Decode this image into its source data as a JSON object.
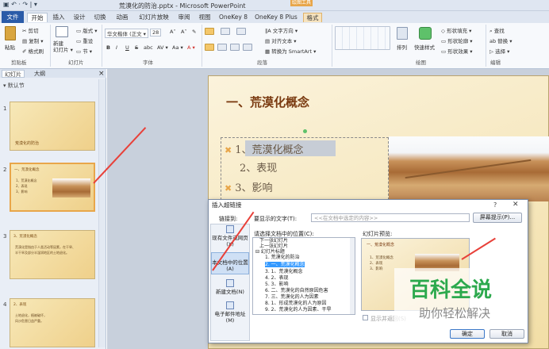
{
  "window": {
    "title": "荒漠化的防治.pptx - Microsoft PowerPoint",
    "quick_access": "▣ ↶ · ↷ | ▾",
    "contextual_group": "绘图工具"
  },
  "tabs": [
    "文件",
    "开始",
    "插入",
    "设计",
    "切换",
    "动画",
    "幻灯片放映",
    "审阅",
    "视图",
    "OneKey 8",
    "OneKey 8 Plus",
    "格式"
  ],
  "ribbon": {
    "clipboard": {
      "paste": "粘贴",
      "cut": "✂ 剪切",
      "copy": "▤ 复制 ▾",
      "format_painter": "✐ 格式刷",
      "label": "剪贴板"
    },
    "slides": {
      "new_slide": "新建\n幻灯片 ▾",
      "layout": "▭ 版式 ▾",
      "reset": "▭ 重设",
      "section": "▭ 节 ▾",
      "label": "幻灯片"
    },
    "font": {
      "name": "华文楷体 (正文 ▾",
      "size": "28",
      "grow": "A˄",
      "shrink": "A˅",
      "clear": "✎",
      "bold": "B",
      "italic": "I",
      "underline": "U",
      "strike": "S",
      "shadow": "abc",
      "spacing": "AV ▾",
      "case": "Aa ▾",
      "color": "A ▾",
      "label": "字体"
    },
    "paragraph": {
      "text_direction": "‖A 文字方向 ▾",
      "align_text": "▤ 对齐文本 ▾",
      "smartart": "▦ 转换为 SmartArt ▾",
      "label": "段落"
    },
    "drawing": {
      "arrange": "排列",
      "quick_styles": "快速样式",
      "fill": "◇ 形状填充 ▾",
      "outline": "▭ 形状轮廓 ▾",
      "effects": "▭ 形状效果 ▾",
      "label": "绘图"
    },
    "editing": {
      "find": "⌕ 查找",
      "replace": "ab 替换 ▾",
      "select": "▷ 选择 ▾",
      "label": "编辑"
    }
  },
  "left_pane": {
    "tabs": [
      "幻灯片",
      "大纲"
    ],
    "close": "×",
    "section": "▾ 默认节",
    "slides": [
      {
        "num": "1",
        "title": "荒漠化的防治",
        "lines": []
      },
      {
        "num": "2",
        "title": "一、荒漠化概念",
        "lines": [
          "1、荒漠化概念",
          "2、表现",
          "3、影响"
        ]
      },
      {
        "num": "3",
        "title": "3、荒漠化概念",
        "lines": [
          "荒漠化是指由于人类活动等因素，在干旱、",
          "半干旱及部分半湿润地区的土地退化。"
        ]
      },
      {
        "num": "4",
        "title": "2、表现",
        "lines": [
          "土地退化，植被破坏，",
          "风沙危害日益严重。"
        ]
      }
    ]
  },
  "slide": {
    "title": "一、荒漠化概念",
    "bullets": [
      {
        "marker": "✖",
        "text": "1、荒漠化概念"
      },
      {
        "marker": "",
        "text": "2、表现"
      },
      {
        "marker": "✖",
        "text": "3、影响"
      }
    ]
  },
  "dialog": {
    "title": "插入超链接",
    "help": "?",
    "close": "✕",
    "link_to": "链接到:",
    "display_text_label": "要显示的文字(T):",
    "display_text_value": "<<在文档中选定的内容>>",
    "screen_tip": "屏幕提示(P)...",
    "place_label": "请选择文档中的位置(C):",
    "preview_label": "幻灯片预览:",
    "link_options": [
      {
        "label": "现有文件或网页(X)",
        "selected": false
      },
      {
        "label": "本文档中的位置(A)",
        "selected": true
      },
      {
        "label": "新建文档(N)",
        "selected": false
      },
      {
        "label": "电子邮件地址(M)",
        "selected": false
      }
    ],
    "tree": [
      {
        "text": "下一张幻灯片",
        "selected": false
      },
      {
        "text": "上一张幻灯片",
        "selected": false
      },
      {
        "text": "⊟ 幻灯片标题",
        "selected": false
      },
      {
        "text": "1. 荒漠化的防治",
        "selected": false
      },
      {
        "text": "2. 一、荒漠化概念",
        "selected": true
      },
      {
        "text": "3. 1、荒漠化概念",
        "selected": false
      },
      {
        "text": "4. 2、表现",
        "selected": false
      },
      {
        "text": "5. 3、影响",
        "selected": false
      },
      {
        "text": "6. 二、荒漠化的自然原因危害",
        "selected": false
      },
      {
        "text": "7. 三、荒漠化的人为因素",
        "selected": false
      },
      {
        "text": "8. 1、形成荒漠化的人为原因",
        "selected": false
      },
      {
        "text": "9. 2、荒漠化的人为因素、干旱",
        "selected": false
      }
    ],
    "preview": {
      "title": "一、荒漠化概念",
      "lines": [
        "1、荒漠化概念",
        "2、表现",
        "3、影响"
      ]
    },
    "show_and_return": "显示并返回(S)",
    "ok": "确定",
    "cancel": "取消"
  },
  "watermark": {
    "title": "百科全说",
    "subtitle": "助你轻松解决"
  },
  "colors": {
    "accent": "#e8a64a",
    "file_tab": "#2a5ba8",
    "title_red": "#7a3a10",
    "arrow": "#e8413a",
    "watermark_green": "#2ca94d"
  }
}
